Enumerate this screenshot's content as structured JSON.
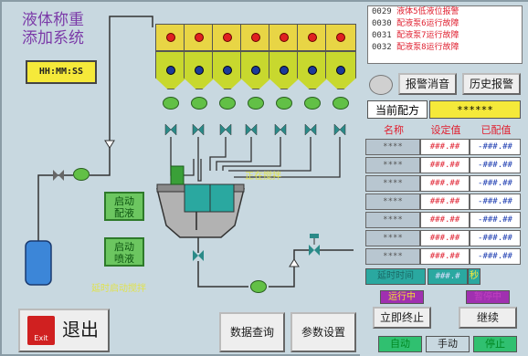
{
  "title": {
    "line1": "液体称重",
    "line2": "添加系统"
  },
  "clock": "HH:MM:SS",
  "status": {
    "running": "正在搅拌",
    "timer": "延时启动搅拌"
  },
  "buttons": {
    "start_dispense": {
      "line1": "启动",
      "line2": "配液"
    },
    "start_spray": {
      "line1": "启动",
      "line2": "喷液"
    },
    "exit": "退出",
    "exit_icon_text": "Exit",
    "data_query": "数据查询",
    "param_setting": "参数设置"
  },
  "alarms": [
    {
      "id": "0029",
      "msg": "液体5低液位报警"
    },
    {
      "id": "0030",
      "msg": "配液泵6运行故障"
    },
    {
      "id": "0031",
      "msg": "配液泵7运行故障"
    },
    {
      "id": "0032",
      "msg": "配液泵8运行故障"
    }
  ],
  "alarm_buttons": {
    "silence": "报警消音",
    "history": "历史报警"
  },
  "recipe": {
    "label": "当前配方",
    "value": "******"
  },
  "table": {
    "headers": [
      "名称",
      "设定值",
      "已配值"
    ],
    "rows": [
      [
        "****",
        "###.##",
        "-###.##"
      ],
      [
        "****",
        "###.##",
        "-###.##"
      ],
      [
        "****",
        "###.##",
        "-###.##"
      ],
      [
        "****",
        "###.##",
        "-###.##"
      ],
      [
        "****",
        "###.##",
        "-###.##"
      ],
      [
        "****",
        "###.##",
        "-###.##"
      ],
      [
        "****",
        "###.##",
        "-###.##"
      ]
    ]
  },
  "timer_row": {
    "label": "延时时间",
    "value": "###.#",
    "unit": "秒"
  },
  "indicators": {
    "running": "运行中",
    "paused": "暂停中"
  },
  "controls": {
    "stop_now": "立即终止",
    "continue": "继续",
    "auto": "自动",
    "manual": "手动",
    "halt": "停止"
  },
  "colors": {
    "background": "#c8d8e0",
    "accent_yellow": "#f5e93a",
    "alarm_red": "#e02030",
    "green": "#6cc660",
    "teal": "#2aa8a0"
  }
}
